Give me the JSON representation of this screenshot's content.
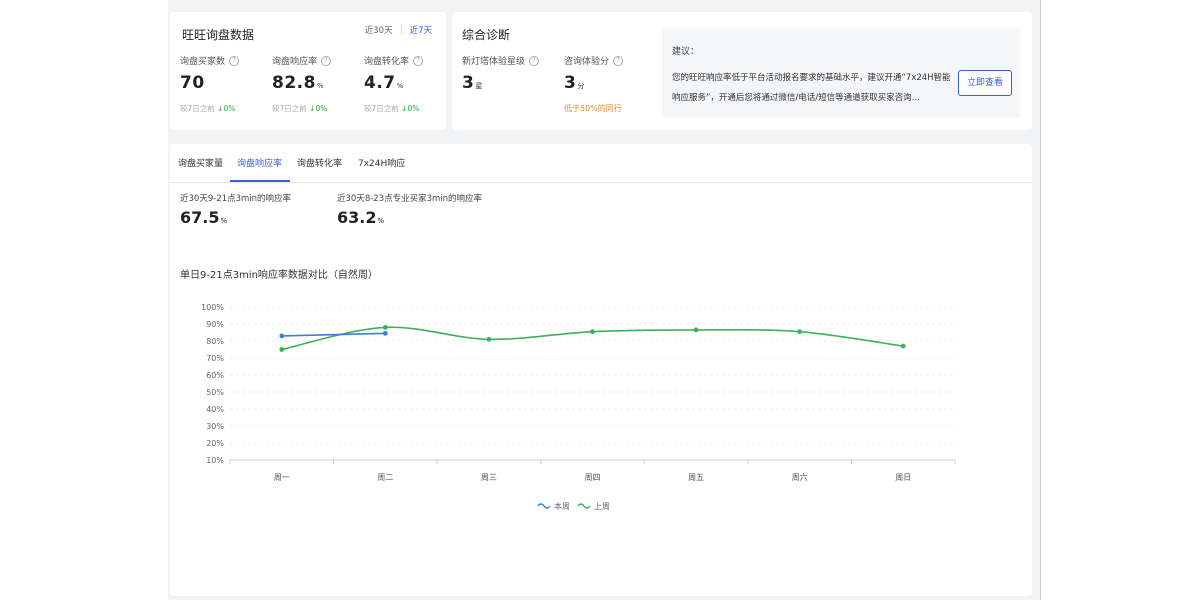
{
  "inquiry_card": {
    "title": "旺旺询盘数据",
    "range_30": "近30天",
    "range_7": "近7天",
    "metrics": [
      {
        "label": "询盘买家数",
        "value": "70",
        "unit": "",
        "compare_text": "较7日之前",
        "compare_value": "↓0%"
      },
      {
        "label": "询盘响应率",
        "value": "82.8",
        "unit": "%",
        "compare_text": "较7日之前",
        "compare_value": "↓0%"
      },
      {
        "label": "询盘转化率",
        "value": "4.7",
        "unit": "%",
        "compare_text": "较7日之前",
        "compare_value": "↓0%"
      }
    ]
  },
  "diagnosis_card": {
    "title": "综合诊断",
    "metrics": [
      {
        "label": "新灯塔体验星级",
        "value": "3",
        "unit": "星"
      },
      {
        "label": "咨询体验分",
        "value": "3",
        "unit": "分",
        "warning": "低于50%的同行"
      }
    ],
    "advice": {
      "title": "建议：",
      "text": "您的旺旺响应率低于平台活动报名要求的基础水平，建议开通“7x24H智能响应服务”，开通后您将通过微信/电话/短信等通道获取买家咨询...",
      "button": "立即查看"
    }
  },
  "tabs": [
    "询盘买家量",
    "询盘响应率",
    "询盘转化率",
    "7x24H响应"
  ],
  "active_tab": "询盘响应率",
  "stats": [
    {
      "label": "近30天9-21点3min的响应率",
      "value": "67.5",
      "unit": "%"
    },
    {
      "label": "近30天8-23点专业买家3min的响应率",
      "value": "63.2",
      "unit": "%"
    }
  ],
  "chart_title": "单日9-21点3min响应率数据对比（自然周）",
  "chart_data": {
    "type": "line",
    "categories": [
      "周一",
      "周二",
      "周三",
      "周四",
      "周五",
      "周六",
      "周日"
    ],
    "y_ticks": [
      "10%",
      "20%",
      "30%",
      "40%",
      "50%",
      "60%",
      "70%",
      "80%",
      "90%",
      "100%"
    ],
    "ylim": [
      10,
      100
    ],
    "grid": true,
    "legend_position": "bottom",
    "series": [
      {
        "name": "本周",
        "color": "#3b7ddd",
        "values": [
          83,
          84.5
        ]
      },
      {
        "name": "上周",
        "color": "#3cb05a",
        "values": [
          75,
          88,
          81,
          85.5,
          86.5,
          85.5,
          77
        ]
      }
    ]
  }
}
